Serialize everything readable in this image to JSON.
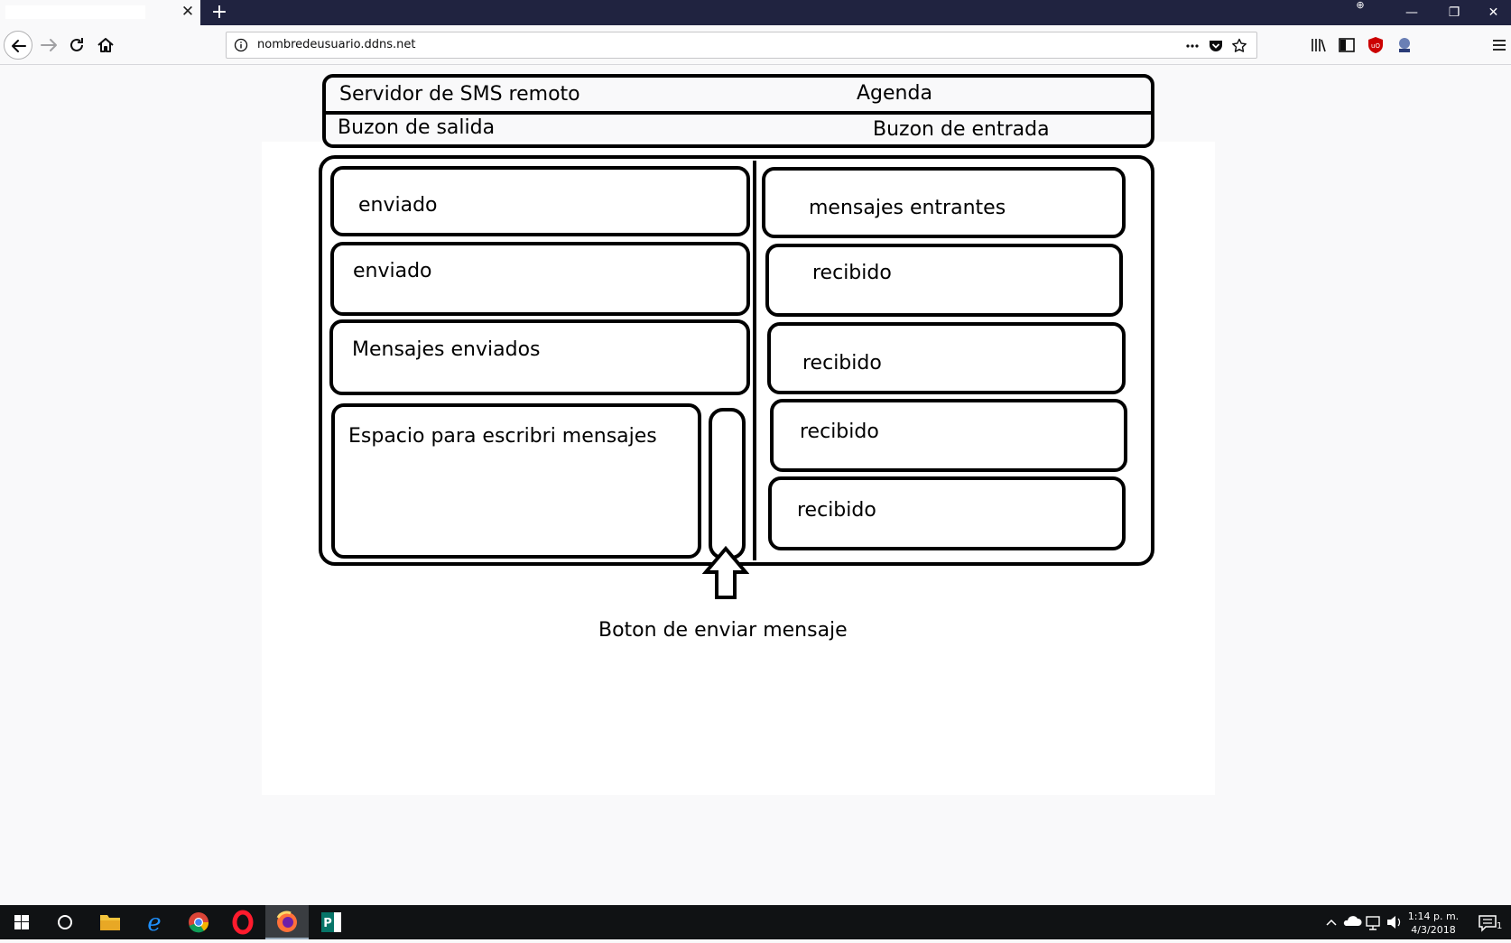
{
  "browser": {
    "url": "nombredeusuario.ddns.net",
    "tab_close": "✕",
    "new_tab": "+",
    "window_controls": {
      "minimize": "—",
      "restore": "❐",
      "close": "✕"
    }
  },
  "header": {
    "server_label": "Servidor de SMS remoto",
    "agenda_label": "Agenda",
    "outbox_label": "Buzon de salida",
    "inbox_label": "Buzon de entrada"
  },
  "outbox": {
    "items": [
      {
        "text": "enviado"
      },
      {
        "text": "enviado"
      },
      {
        "text": "Mensajes enviados"
      }
    ],
    "compose_label": "Espacio para escribri mensajes"
  },
  "inbox": {
    "items": [
      {
        "text": "mensajes entrantes"
      },
      {
        "text": "recibido"
      },
      {
        "text": "recibido"
      },
      {
        "text": "recibido"
      },
      {
        "text": "recibido"
      }
    ]
  },
  "send_caption": "Boton de enviar mensaje",
  "taskbar": {
    "time": "1:14 p. m.",
    "date": "4/3/2018",
    "notification_count": "1",
    "apps": [
      "start",
      "cortana",
      "file-explorer",
      "edge",
      "chrome",
      "opera",
      "firefox",
      "publisher"
    ]
  },
  "colors": {
    "titlebar": "#202340",
    "taskbar": "#101214",
    "page_background": "#f9f9fa",
    "ink": "#000000"
  }
}
